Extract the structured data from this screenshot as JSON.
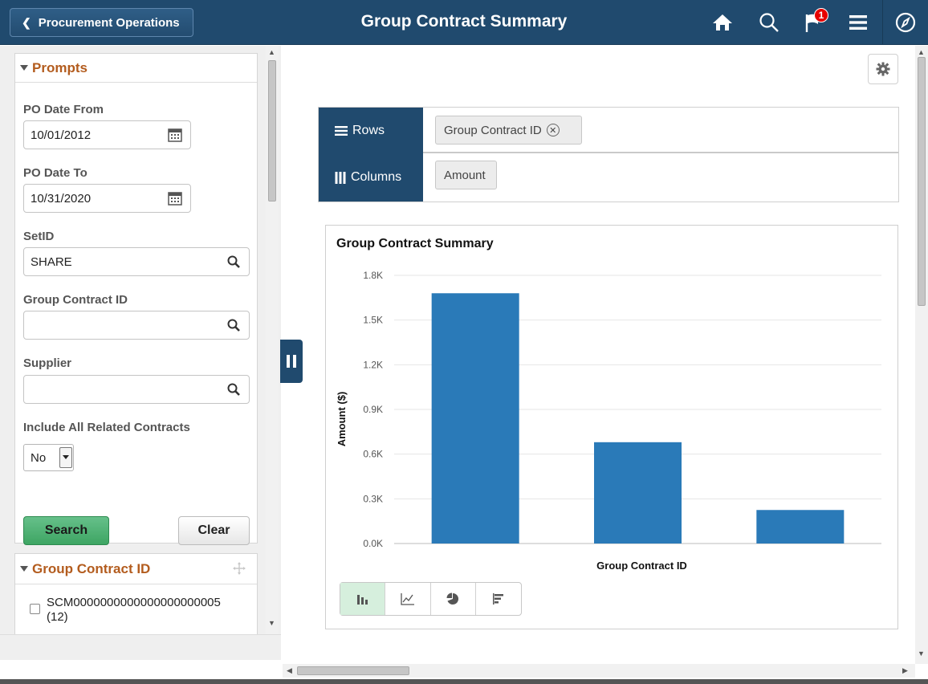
{
  "header": {
    "back_label": "Procurement Operations",
    "title": "Group Contract Summary",
    "notification_count": "1",
    "icons": [
      "home-icon",
      "search-icon",
      "notification-flag-icon",
      "hamburger-menu-icon",
      "navbar-compass-icon"
    ]
  },
  "prompts": {
    "heading": "Prompts",
    "po_date_from_label": "PO Date From",
    "po_date_from_value": "10/01/2012",
    "po_date_to_label": "PO Date To",
    "po_date_to_value": "10/31/2020",
    "setid_label": "SetID",
    "setid_value": "SHARE",
    "group_contract_label": "Group Contract ID",
    "group_contract_value": "",
    "supplier_label": "Supplier",
    "supplier_value": "",
    "include_label": "Include All Related Contracts",
    "include_value": "No",
    "search_label": "Search",
    "clear_label": "Clear"
  },
  "facet": {
    "heading": "Group Contract ID",
    "items": [
      {
        "label": "SCM0000000000000000000005",
        "count": "(12)",
        "checked": false
      }
    ]
  },
  "pivot": {
    "rows_label": "Rows",
    "columns_label": "Columns",
    "row_chip": "Group Contract ID",
    "column_chip": "Amount"
  },
  "chart_types": [
    "bar-chart-icon",
    "line-chart-icon",
    "pie-chart-icon",
    "horizontal-bar-chart-icon"
  ],
  "chart_data": {
    "type": "bar",
    "title": "Group Contract Summary",
    "xlabel": "Group Contract ID",
    "ylabel": "Amount ($)",
    "ylim": [
      0,
      1800
    ],
    "yticks": [
      0,
      300,
      600,
      900,
      1200,
      1500,
      1800
    ],
    "ytick_labels": [
      "0.0K",
      "0.3K",
      "0.6K",
      "0.9K",
      "1.2K",
      "1.5K",
      "1.8K"
    ],
    "categories": [
      "",
      "",
      ""
    ],
    "values": [
      1680,
      680,
      225
    ],
    "color": "#2a7ab8"
  },
  "colors": {
    "header": "#204a6e",
    "accent_orange": "#b35c1e",
    "search_green": "#3ea563",
    "bar": "#2a7ab8"
  }
}
